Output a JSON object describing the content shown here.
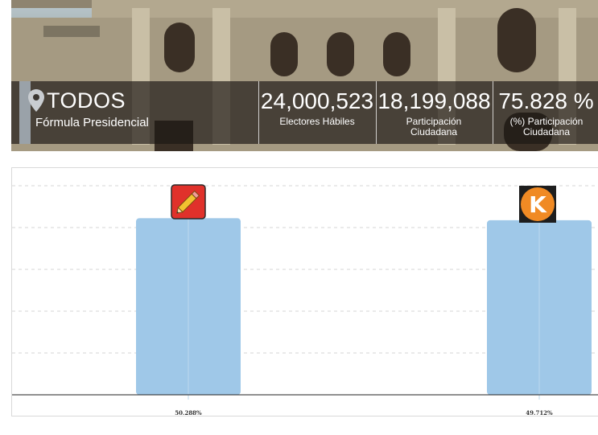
{
  "header": {
    "location_title": "TODOS",
    "location_subtitle": "Fórmula Presidencial",
    "stats": [
      {
        "value": "24,000,523",
        "label": "Electores Hábiles"
      },
      {
        "value": "18,199,088",
        "label": "Participación Ciudadana"
      },
      {
        "value": "75.828 %",
        "label": "(%) Participación Ciudadana"
      }
    ]
  },
  "chart_data": {
    "type": "bar",
    "categories": [
      "pencil-party",
      "k-party"
    ],
    "values": [
      50.288,
      49.712
    ],
    "value_labels": [
      "50.288%",
      "49.712%"
    ],
    "ylim": [
      0,
      60
    ],
    "grid": true,
    "bar_color": "#9fc8e8"
  },
  "logos": [
    {
      "icon": "pencil-icon",
      "bg": "#e0312b"
    },
    {
      "icon": "k-logo-icon",
      "bg": "#f08a24"
    }
  ]
}
